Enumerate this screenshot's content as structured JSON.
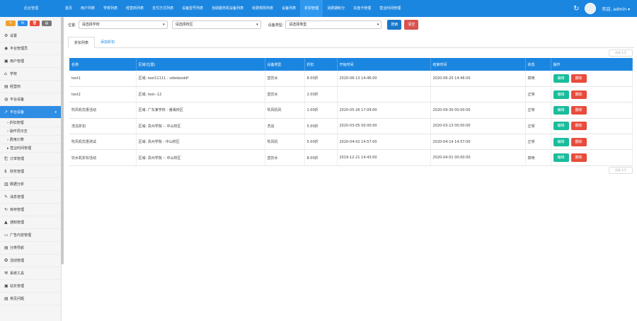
{
  "header": {
    "brand": "后台管理",
    "nav": [
      "首页",
      "用户列表",
      "学校列表",
      "经营商列表",
      "支付方式列表",
      "设备型号列表",
      "自助服务机设备列表",
      "收费规则列表",
      "设备列表",
      "折扣管理",
      "消费期积分",
      "充值卡管理",
      "营业时间管理"
    ],
    "active_index": 9,
    "welcome": "欢迎, admin ▾"
  },
  "sidebar": {
    "top_buttons": [
      "✎",
      "✉",
      "🗑",
      "▤"
    ],
    "items": [
      {
        "icon": "⚙",
        "label": "设置"
      },
      {
        "icon": "◉",
        "label": "平台管理员"
      },
      {
        "icon": "▣",
        "label": "用户管理"
      },
      {
        "icon": "⌂",
        "label": "学校"
      },
      {
        "icon": "▤",
        "label": "经营商"
      },
      {
        "icon": "◍",
        "label": "平台设备"
      },
      {
        "icon": "↗",
        "label": "平台设备",
        "active": true
      }
    ],
    "sub_items": [
      "折扣管理",
      "操作员日志",
      "费用计算",
      "营业时间管理"
    ],
    "items_after": [
      {
        "icon": "⎗",
        "label": "订单管理"
      },
      {
        "icon": "$",
        "label": "财务管理"
      },
      {
        "icon": "▥",
        "label": "数据分析"
      },
      {
        "icon": "✎",
        "label": "消息管理"
      },
      {
        "icon": "↻",
        "label": "库存管理"
      },
      {
        "icon": "▲",
        "label": "通知管理"
      },
      {
        "icon": "▭",
        "label": "广告内容管理"
      },
      {
        "icon": "▤",
        "label": "分类导航"
      },
      {
        "icon": "✪",
        "label": "活动管理"
      },
      {
        "icon": "⚒",
        "label": "系统工具"
      },
      {
        "icon": "▣",
        "label": "站长管理"
      },
      {
        "icon": "▤",
        "label": "常见问题"
      }
    ]
  },
  "filters": {
    "location_label": "位置:",
    "location_value": "请选择学校",
    "area_value": "请选择校区",
    "type_label": "设备类型:",
    "type_value": "请选择类型",
    "search_label": "搜索",
    "reset_label": "清空"
  },
  "tabs": {
    "list": "折扣列表",
    "add": "添加折扣"
  },
  "pager_label": "折扣 1/1",
  "table": {
    "headers": [
      "名称",
      "区域(位置)",
      "设备类型",
      "折扣",
      "开始时间",
      "结束时间",
      "状态",
      "操作"
    ],
    "rows": [
      [
        "test1",
        "区域: test11111 - sdwdasddf",
        "直饮水",
        "8.00折",
        "2020-06-13 14:46:00",
        "2020-06-20 14:46:00",
        "禁用"
      ],
      [
        "test2",
        "区域: test--12",
        "直饮水",
        "2.00折",
        "",
        "",
        "正常"
      ],
      [
        "吹风机优惠活动",
        "区域: 广东某学校 - 番禺校区",
        "吹风机风",
        "1.00折",
        "2020-05-26 17:09:00",
        "2020-09-30 00:00:00",
        "正常"
      ],
      [
        "洗浴折扣",
        "区域: 贵州学院 -- 中山校区",
        "洗浴",
        "5.00折",
        "2020-03-05 00:00:00",
        "2020-03-13 00:00:00",
        "正常"
      ],
      [
        "吹风机优惠测试",
        "区域: 贵州学院 - 中山校区",
        "吹风机",
        "5.00折",
        "2020-04-02 14:57:00",
        "2020-04-14 14:57:00",
        "正常"
      ],
      [
        "饮水机折扣活动",
        "区域: 贵州学院 -- 中山校区",
        "直饮水",
        "8.00折",
        "2019-12-21 14:43:00",
        "2020-04-01 00:00:00",
        "禁用"
      ]
    ],
    "edit_label": "编辑",
    "delete_label": "删除"
  }
}
